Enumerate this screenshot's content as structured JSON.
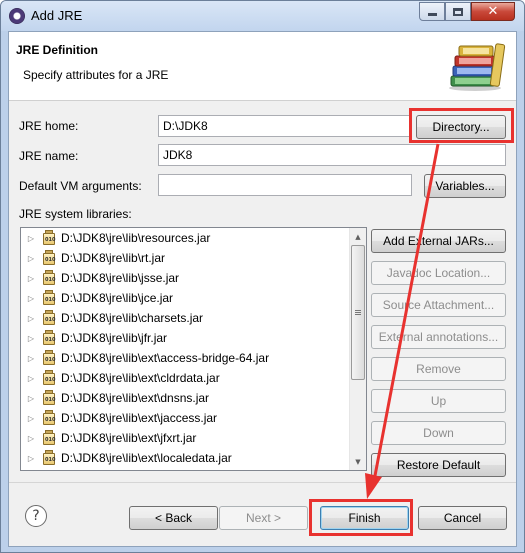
{
  "window": {
    "title": "Add JRE",
    "icon": "eclipse-icon",
    "caption_buttons": [
      "minimize",
      "maximize",
      "close"
    ]
  },
  "header": {
    "title": "JRE Definition",
    "description": "Specify attributes for a JRE",
    "banner_icon": "library-books-icon"
  },
  "form": {
    "jre_home_label": "JRE home:",
    "jre_home_value": "D:\\JDK8",
    "directory_button": "Directory...",
    "jre_name_label": "JRE name:",
    "jre_name_value": "JDK8",
    "vm_args_label": "Default VM arguments:",
    "vm_args_value": "",
    "variables_button": "Variables...",
    "libraries_label": "JRE system libraries:"
  },
  "libraries": [
    "D:\\JDK8\\jre\\lib\\resources.jar",
    "D:\\JDK8\\jre\\lib\\rt.jar",
    "D:\\JDK8\\jre\\lib\\jsse.jar",
    "D:\\JDK8\\jre\\lib\\jce.jar",
    "D:\\JDK8\\jre\\lib\\charsets.jar",
    "D:\\JDK8\\jre\\lib\\jfr.jar",
    "D:\\JDK8\\jre\\lib\\ext\\access-bridge-64.jar",
    "D:\\JDK8\\jre\\lib\\ext\\cldrdata.jar",
    "D:\\JDK8\\jre\\lib\\ext\\dnsns.jar",
    "D:\\JDK8\\jre\\lib\\ext\\jaccess.jar",
    "D:\\JDK8\\jre\\lib\\ext\\jfxrt.jar",
    "D:\\JDK8\\jre\\lib\\ext\\localedata.jar"
  ],
  "library_buttons": {
    "add_external_jars": "Add External JARs...",
    "javadoc_location": "Javadoc Location...",
    "source_attachment": "Source Attachment...",
    "external_annotations": "External annotations...",
    "remove": "Remove",
    "up": "Up",
    "down": "Down",
    "restore_default": "Restore Default"
  },
  "footer": {
    "help": "?",
    "back": "< Back",
    "next": "Next >",
    "finish": "Finish",
    "cancel": "Cancel"
  },
  "annotation": {
    "color": "#e8322f"
  }
}
